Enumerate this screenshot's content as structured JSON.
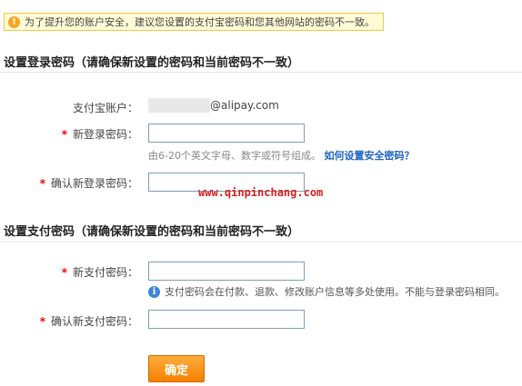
{
  "notice": {
    "icon": "exclamation-icon",
    "text": "为了提升您的账户安全，建议您设置的支付宝密码和您其他网站的密码不一致。"
  },
  "login_section": {
    "title": "设置登录密码（请确保新设置的密码和当前密码不一致）",
    "account_label": "支付宝账户：",
    "account_suffix": "@alipay.com",
    "new_label": "新登录密码：",
    "hint": "由6-20个英文字母、数字或符号组成。",
    "hint_link": "如何设置安全密码？",
    "confirm_label": "确认新登录密码："
  },
  "watermark": "www.qinpinchang.com",
  "pay_section": {
    "title": "设置支付密码（请确保新设置的密码和当前密码不一致）",
    "new_label": "新支付密码：",
    "info": "支付密码会在付款、退款、修改账户信息等多处使用。不能与登录密码相同。",
    "confirm_label": "确认新支付密码："
  },
  "required_mark": "*",
  "submit_label": "确定"
}
